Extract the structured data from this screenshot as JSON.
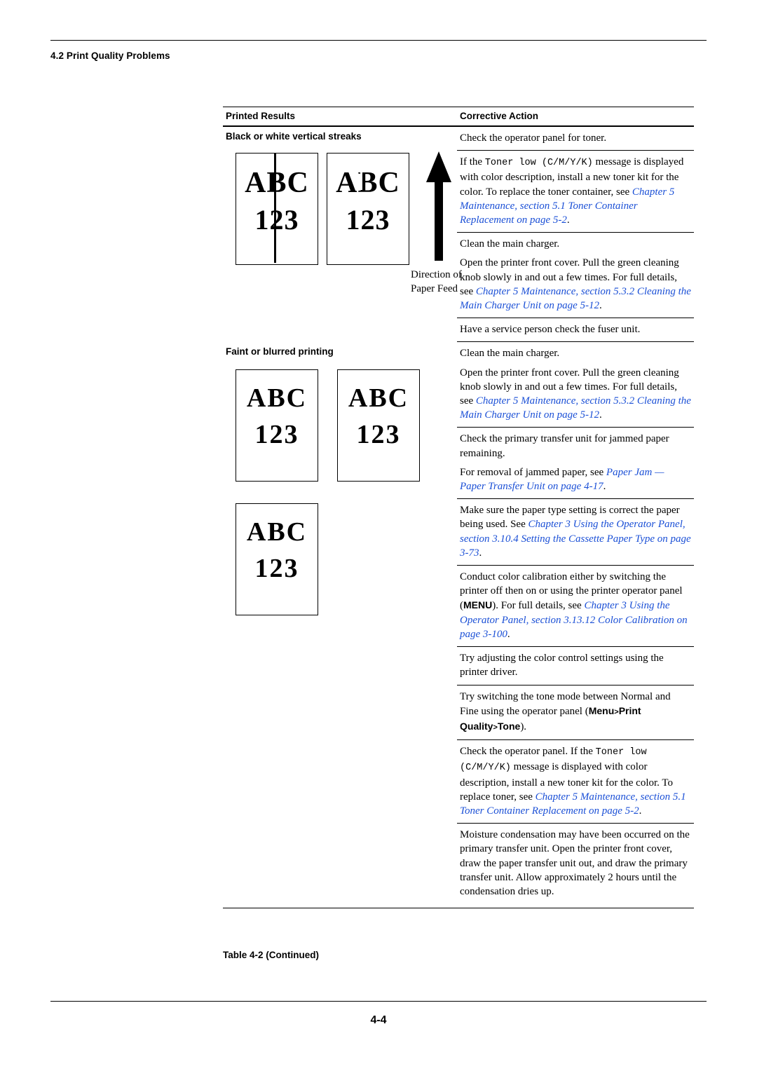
{
  "header": {
    "section": "4.2 Print Quality Problems"
  },
  "footer": {
    "page_number": "4-4"
  },
  "table": {
    "caption": "Table 4-2  (Continued)",
    "columns": {
      "left": "Printed Results",
      "right": "Corrective Action"
    },
    "rows": [
      {
        "symptom": "Black or white vertical streaks",
        "sample_labels": {
          "line1": "ABC",
          "line2": "123",
          "direction": "Direction of Paper Feed"
        },
        "actions": [
          {
            "parts": [
              {
                "text": "Check the operator panel for toner.",
                "style": "plain"
              }
            ]
          },
          {
            "parts": [
              {
                "text": "If the ",
                "style": "plain"
              },
              {
                "text": "Toner low (C/M/Y/K)",
                "style": "mono"
              },
              {
                "text": " message is displayed with color description, install a new toner kit for the color. To replace the toner container, see ",
                "style": "plain"
              },
              {
                "text": "Chapter 5 Maintenance, section 5.1 Toner Container Replacement on page 5-2",
                "style": "ref"
              },
              {
                "text": ".",
                "style": "plain"
              }
            ]
          },
          {
            "parts": [
              {
                "text": "Clean the main charger.",
                "style": "plain"
              }
            ]
          },
          {
            "parts": [
              {
                "text": "Open the printer front cover. Pull the green cleaning knob slowly in and out a few times. For full details, see ",
                "style": "plain"
              },
              {
                "text": "Chapter 5 Maintenance, section 5.3.2 Cleaning the Main Charger Unit on page 5-12",
                "style": "ref"
              },
              {
                "text": ".",
                "style": "plain"
              }
            ]
          },
          {
            "parts": [
              {
                "text": "Have a service person check the fuser unit.",
                "style": "plain"
              }
            ]
          }
        ]
      },
      {
        "symptom": "Faint or blurred printing",
        "sample_labels": {
          "line1": "ABC",
          "line2": "123"
        },
        "actions": [
          {
            "parts": [
              {
                "text": "Clean the main charger.",
                "style": "plain"
              }
            ]
          },
          {
            "parts": [
              {
                "text": "Open the printer front cover. Pull the green cleaning knob slowly in and out a few times. For full details, see ",
                "style": "plain"
              },
              {
                "text": "Chapter 5 Maintenance, section 5.3.2 Cleaning the Main Charger Unit on page 5-12",
                "style": "ref"
              },
              {
                "text": ".",
                "style": "plain"
              }
            ]
          },
          {
            "parts": [
              {
                "text": "Check the primary transfer unit for jammed paper remaining.",
                "style": "plain"
              }
            ]
          },
          {
            "parts": [
              {
                "text": "For removal of jammed paper, see ",
                "style": "plain"
              },
              {
                "text": "Paper Jam — Paper Transfer Unit on page 4-17",
                "style": "ref"
              },
              {
                "text": ".",
                "style": "plain"
              }
            ]
          },
          {
            "parts": [
              {
                "text": "Make sure the paper type setting is correct the paper being used. See ",
                "style": "plain"
              },
              {
                "text": "Chapter 3 Using the Operator Panel, section 3.10.4 Setting the Cassette Paper Type on page 3-73",
                "style": "ref"
              },
              {
                "text": ".",
                "style": "plain"
              }
            ]
          },
          {
            "parts": [
              {
                "text": "Conduct color calibration either by switching the printer off then on or using the printer operator panel (",
                "style": "plain"
              },
              {
                "text": "MENU",
                "style": "sansb"
              },
              {
                "text": "). For full details, see ",
                "style": "plain"
              },
              {
                "text": "Chapter 3 Using the Operator Panel, section 3.13.12 Color Calibration on page 3-100",
                "style": "ref"
              },
              {
                "text": ".",
                "style": "plain"
              }
            ]
          },
          {
            "parts": [
              {
                "text": "Try adjusting the color control settings using the printer driver.",
                "style": "plain"
              }
            ]
          },
          {
            "parts": [
              {
                "text": "Try switching the tone mode between Normal and Fine using the operator panel (",
                "style": "plain"
              },
              {
                "text": "Menu>Print Quality>Tone",
                "style": "sansb"
              },
              {
                "text": ").",
                "style": "plain"
              }
            ]
          },
          {
            "parts": [
              {
                "text": "Check the operator panel. If the ",
                "style": "plain"
              },
              {
                "text": "Toner low (C/M/Y/K)",
                "style": "mono"
              },
              {
                "text": " message is displayed with color description, install a new toner kit for the color. To replace toner, see ",
                "style": "plain"
              },
              {
                "text": "Chapter 5 Maintenance, section 5.1 Toner Container Replacement on page 5-2",
                "style": "ref"
              },
              {
                "text": ".",
                "style": "plain"
              }
            ]
          },
          {
            "parts": [
              {
                "text": "Moisture condensation may have been occurred on the primary transfer unit. Open the printer front cover, draw the paper transfer unit out, and draw the primary transfer unit. Allow approximately 2 hours until the condensation dries up.",
                "style": "plain"
              }
            ]
          }
        ]
      }
    ]
  },
  "colors": {
    "reference_link": "#1a4fd6",
    "text": "#000000",
    "rule": "#000000"
  }
}
